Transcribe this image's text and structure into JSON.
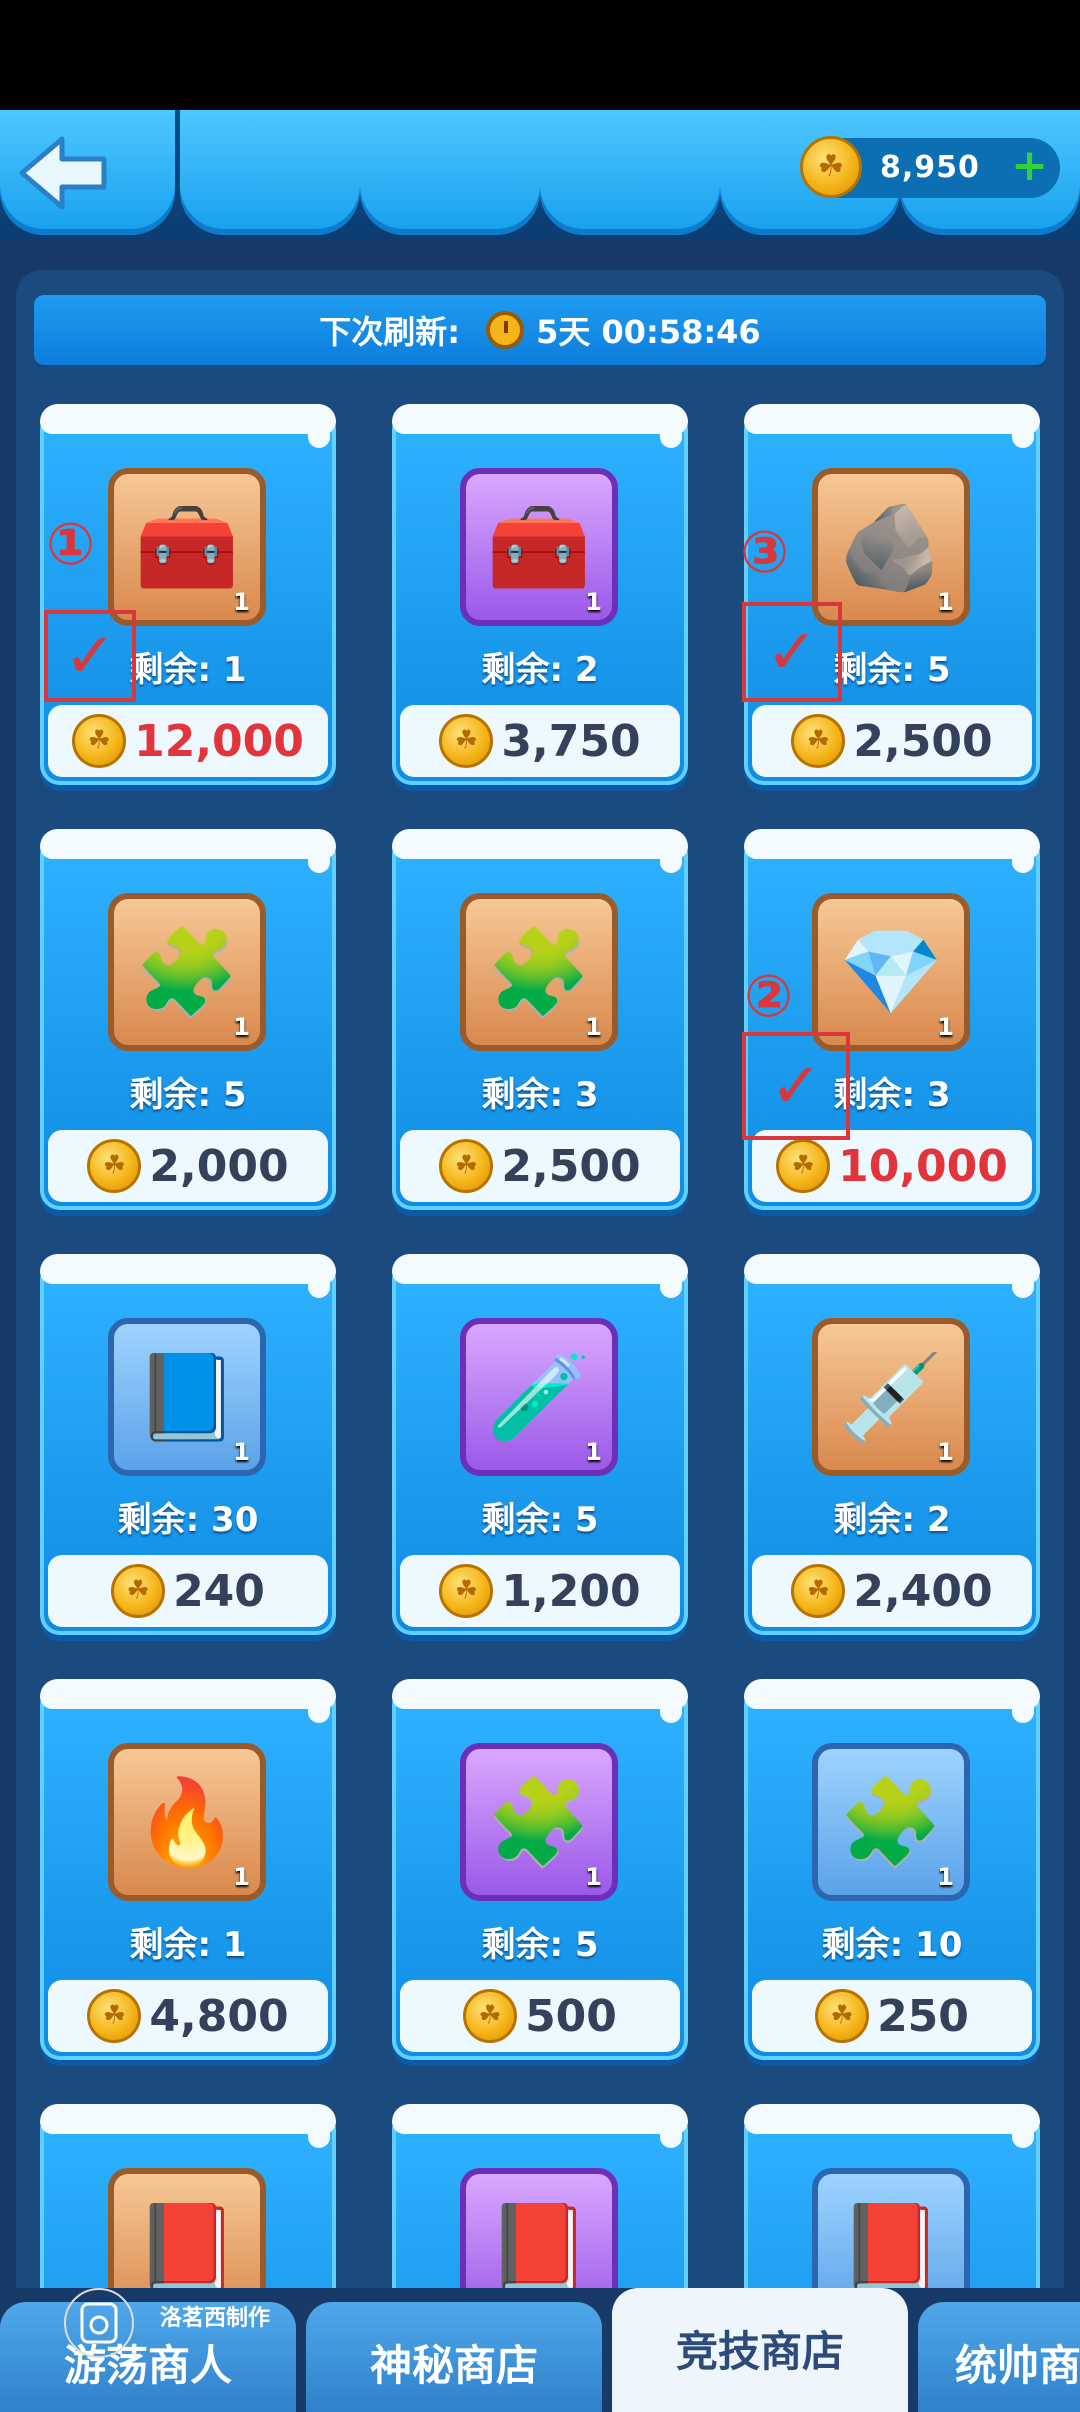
{
  "header": {
    "coin_balance": "8,950",
    "refresh_label": "下次刷新:",
    "refresh_time": "5天 00:58:46"
  },
  "items": [
    {
      "stock": "剩余: 1",
      "price": "12,000",
      "price_color": "#e2343b",
      "icon": "treasure-chest-icon",
      "qty": "1",
      "tile": "orange"
    },
    {
      "stock": "剩余: 2",
      "price": "3,750",
      "price_color": "#34415a",
      "icon": "treasure-chest-icon",
      "qty": "1",
      "tile": "purple"
    },
    {
      "stock": "剩余: 5",
      "price": "2,500",
      "price_color": "#34415a",
      "icon": "hammer-stone-icon",
      "qty": "1",
      "tile": "orange"
    },
    {
      "stock": "剩余: 5",
      "price": "2,000",
      "price_color": "#34415a",
      "icon": "hero-puzzle-icon",
      "qty": "1",
      "tile": "orange"
    },
    {
      "stock": "剩余: 3",
      "price": "2,500",
      "price_color": "#34415a",
      "icon": "puzzle-piece-icon",
      "qty": "1",
      "tile": "orange"
    },
    {
      "stock": "剩余: 3",
      "price": "10,000",
      "price_color": "#e2343b",
      "icon": "crystal-icon",
      "qty": "1",
      "tile": "orange"
    },
    {
      "stock": "剩余: 30",
      "price": "240",
      "price_color": "#34415a",
      "icon": "pet-book-icon",
      "qty": "1",
      "tile": "blue"
    },
    {
      "stock": "剩余: 5",
      "price": "1,200",
      "price_color": "#34415a",
      "icon": "potion-icon",
      "qty": "1",
      "tile": "purple"
    },
    {
      "stock": "剩余: 2",
      "price": "2,400",
      "price_color": "#34415a",
      "icon": "syringe-icon",
      "qty": "1",
      "tile": "orange"
    },
    {
      "stock": "剩余: 1",
      "price": "4,800",
      "price_color": "#34415a",
      "icon": "fire-stone-icon",
      "qty": "1",
      "tile": "orange"
    },
    {
      "stock": "剩余: 5",
      "price": "500",
      "price_color": "#34415a",
      "icon": "puzzle-piece-icon",
      "qty": "1",
      "tile": "purple"
    },
    {
      "stock": "剩余: 10",
      "price": "250",
      "price_color": "#34415a",
      "icon": "puzzle-piece-icon",
      "qty": "1",
      "tile": "blue"
    },
    {
      "icon": "skill-book-icon",
      "tile": "orange"
    },
    {
      "icon": "skill-book-icon",
      "tile": "purple"
    },
    {
      "icon": "skill-book-icon",
      "tile": "blue"
    }
  ],
  "annotations": [
    {
      "label": "①"
    },
    {
      "label": "②"
    },
    {
      "label": "③"
    }
  ],
  "bottom_tabs": [
    {
      "label": "游荡商人"
    },
    {
      "label": "神秘商店"
    },
    {
      "label": "竞技商店",
      "active": true
    },
    {
      "label": "统帅商"
    }
  ],
  "watermark": "洛茗西制作"
}
